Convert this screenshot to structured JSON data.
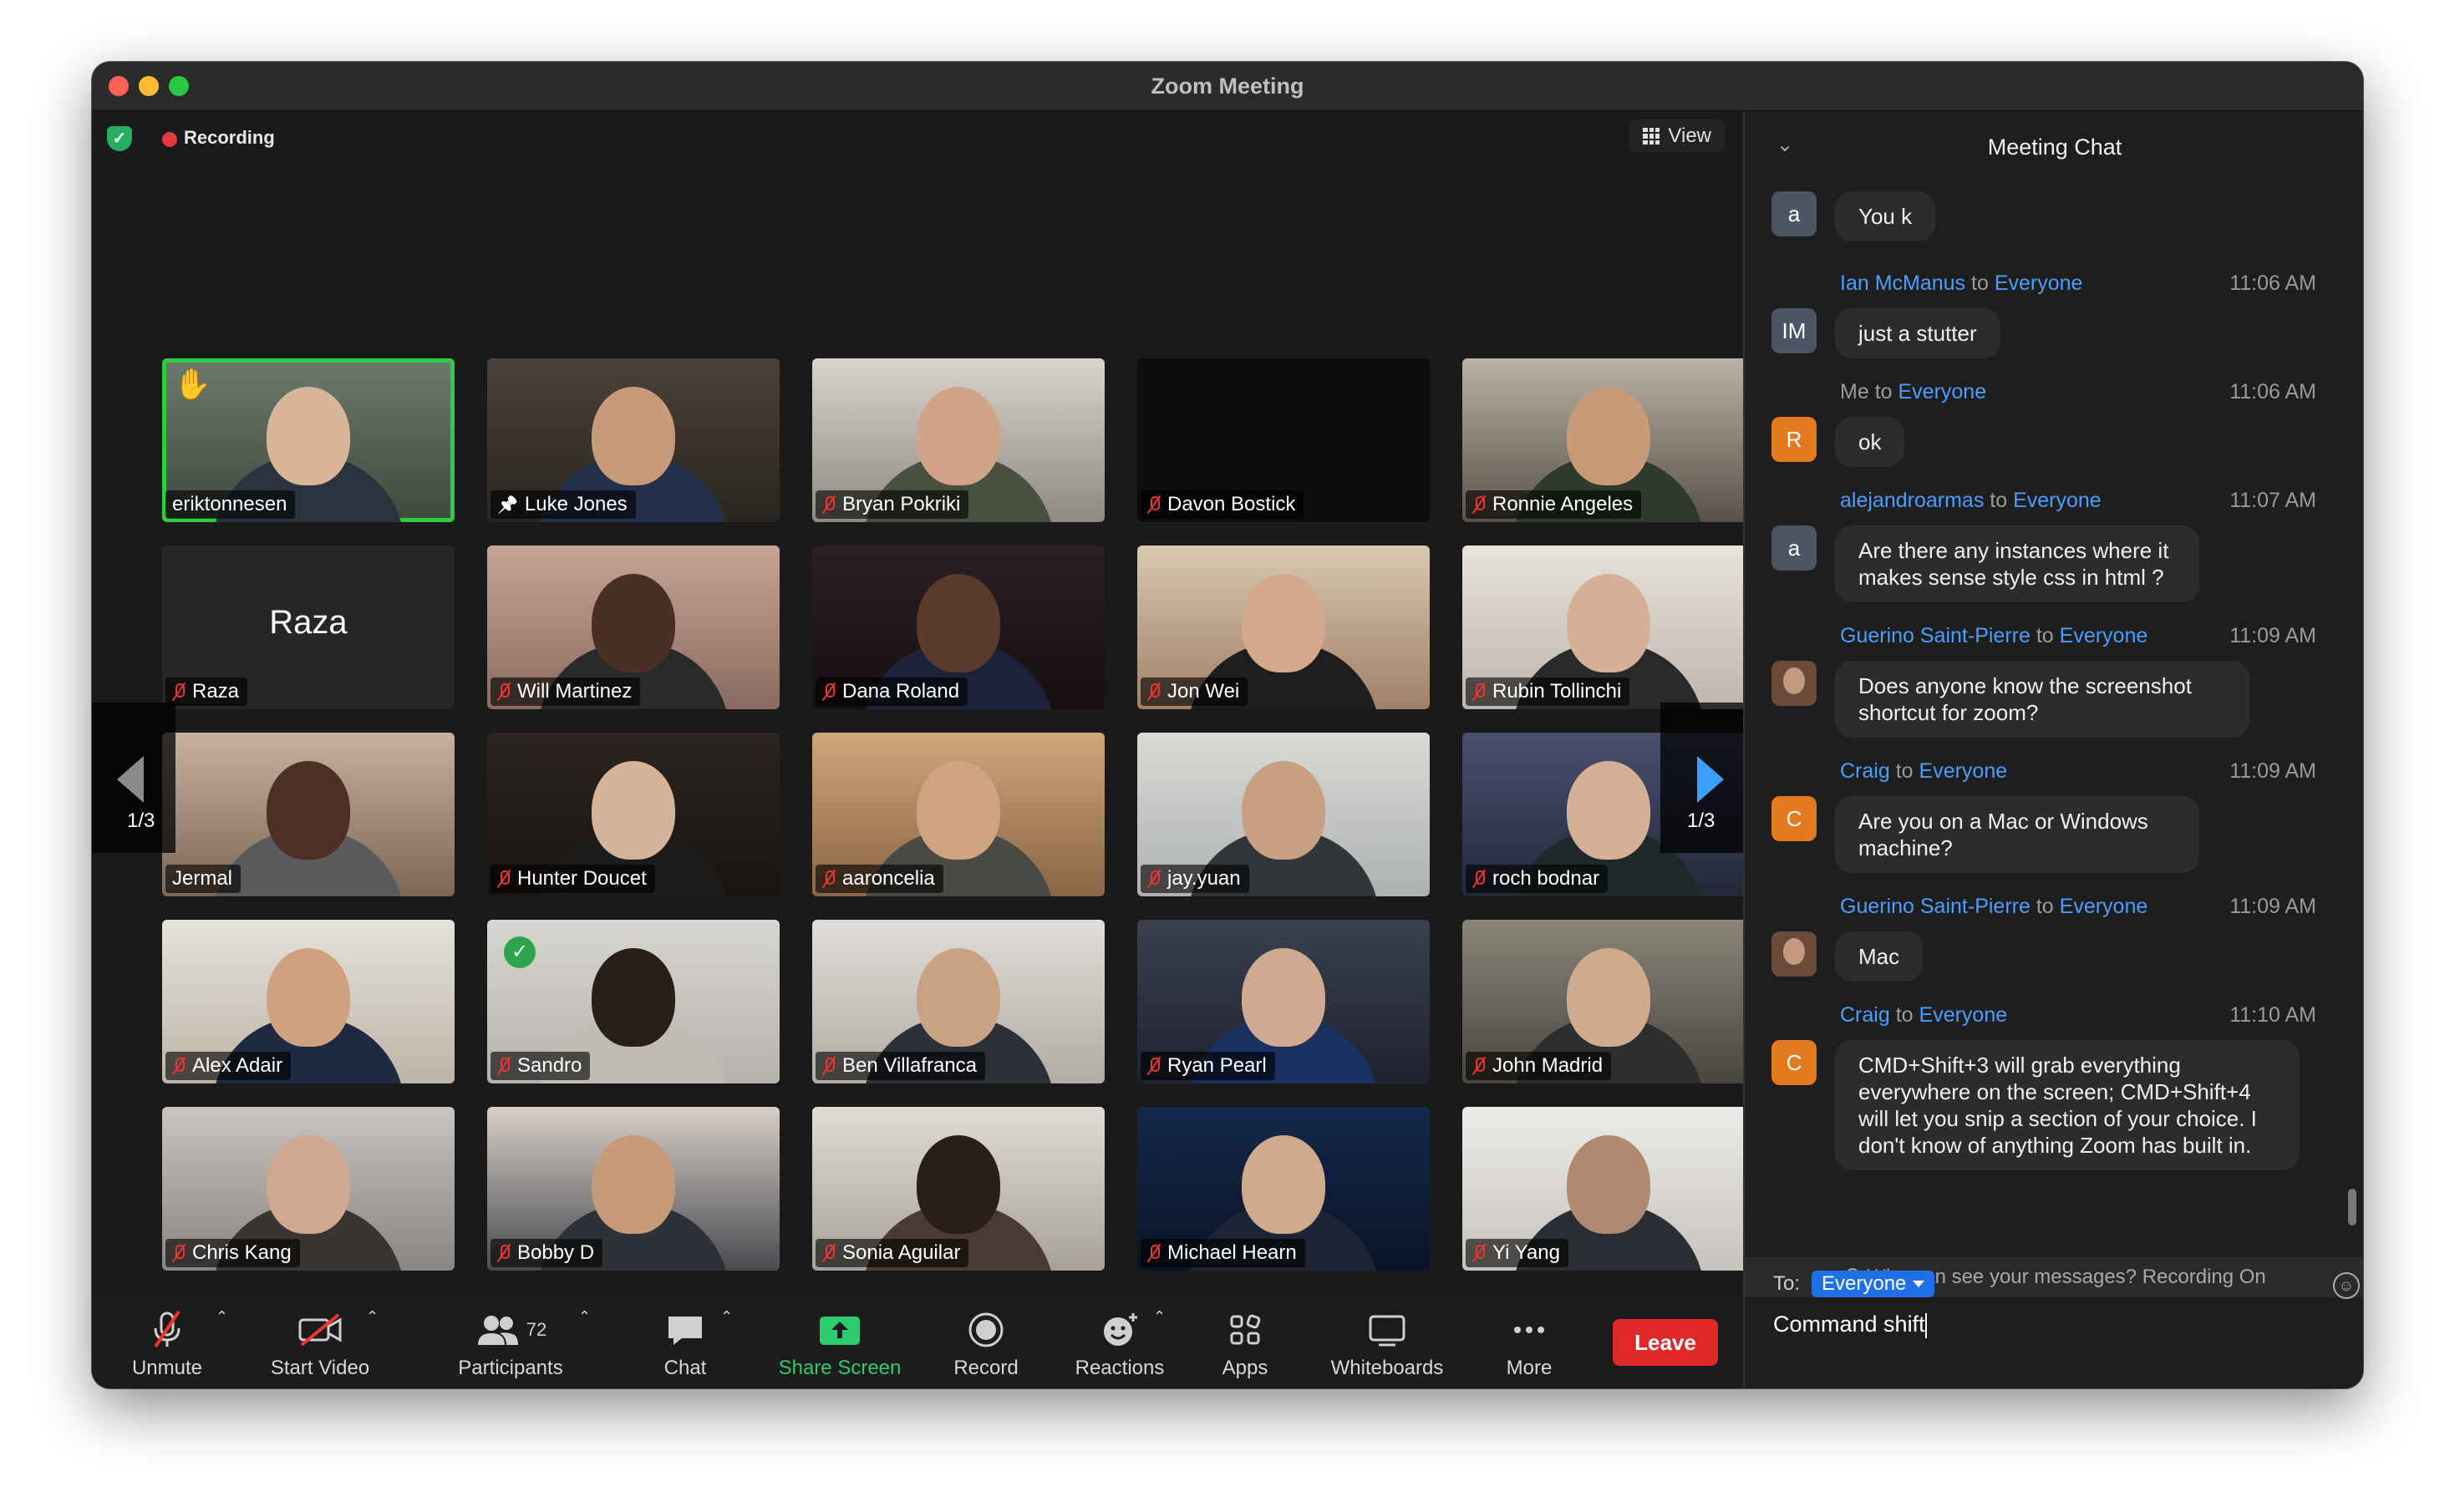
{
  "window": {
    "title": "Zoom Meeting"
  },
  "status": {
    "recording_label": "Recording",
    "view_label": "View"
  },
  "pagination": {
    "left": "1/3",
    "right": "1/3"
  },
  "participants": [
    {
      "name": "eriktonnesen",
      "muted": false,
      "active_speaker": true,
      "hand_raised": true,
      "pinned": false
    },
    {
      "name": "Luke Jones",
      "muted": false,
      "pinned": true
    },
    {
      "name": "Bryan Pokriki",
      "muted": true
    },
    {
      "name": "Davon Bostick",
      "muted": true,
      "video_off": true
    },
    {
      "name": "Ronnie Angeles",
      "muted": true
    },
    {
      "name": "Raza",
      "muted": true,
      "video_off": true,
      "display_name_large": "Raza"
    },
    {
      "name": "Will Martinez",
      "muted": true
    },
    {
      "name": "Dana Roland",
      "muted": true
    },
    {
      "name": "Jon Wei",
      "muted": true
    },
    {
      "name": "Rubin Tollinchi",
      "muted": true
    },
    {
      "name": "Jermal",
      "muted": false
    },
    {
      "name": "Hunter Doucet",
      "muted": true
    },
    {
      "name": "aaroncelia",
      "muted": true
    },
    {
      "name": "jay.yuan",
      "muted": true
    },
    {
      "name": "roch bodnar",
      "muted": true
    },
    {
      "name": "Alex Adair",
      "muted": true
    },
    {
      "name": "Sandro",
      "muted": true,
      "badge": "check"
    },
    {
      "name": "Ben Villafranca",
      "muted": true
    },
    {
      "name": "Ryan Pearl",
      "muted": true
    },
    {
      "name": "John Madrid",
      "muted": true
    },
    {
      "name": "Chris Kang",
      "muted": true
    },
    {
      "name": "Bobby D",
      "muted": true
    },
    {
      "name": "Sonia Aguilar",
      "muted": true
    },
    {
      "name": "Michael Hearn",
      "muted": true
    },
    {
      "name": "Yi Yang",
      "muted": true
    }
  ],
  "toolbar": {
    "unmute": "Unmute",
    "start_video": "Start Video",
    "participants": "Participants",
    "participants_count": "72",
    "chat": "Chat",
    "share_screen": "Share Screen",
    "record": "Record",
    "reactions": "Reactions",
    "apps": "Apps",
    "whiteboards": "Whiteboards",
    "more": "More",
    "leave": "Leave"
  },
  "chat": {
    "title": "Meeting Chat",
    "messages": [
      {
        "avatar": "a",
        "avatar_color": "gray",
        "sender": "",
        "recipient": "",
        "time": "",
        "text": "You k"
      },
      {
        "avatar": "IM",
        "avatar_color": "gray",
        "sender": "Ian McManus",
        "to_word": "to",
        "recipient": "Everyone",
        "time": "11:06 AM",
        "text": "just a stutter"
      },
      {
        "avatar": "R",
        "avatar_color": "orange",
        "sender": "Me",
        "to_word": "to",
        "recipient": "Everyone",
        "time": "11:06 AM",
        "text": "ok"
      },
      {
        "avatar": "a",
        "avatar_color": "gray",
        "sender": "alejandroarmas",
        "to_word": "to",
        "recipient": "Everyone",
        "time": "11:07 AM",
        "text": "Are there any instances where it makes sense style css in html ?"
      },
      {
        "avatar": "",
        "avatar_color": "photo",
        "sender": "Guerino Saint-Pierre",
        "to_word": "to",
        "recipient": "Everyone",
        "time": "11:09 AM",
        "text": "Does anyone know the screenshot shortcut for zoom?"
      },
      {
        "avatar": "C",
        "avatar_color": "orange",
        "sender": "Craig",
        "to_word": "to",
        "recipient": "Everyone",
        "time": "11:09 AM",
        "text": "Are you on a Mac or Windows machine?"
      },
      {
        "avatar": "",
        "avatar_color": "photo",
        "sender": "Guerino Saint-Pierre",
        "to_word": "to",
        "recipient": "Everyone",
        "time": "11:09 AM",
        "text": "Mac"
      },
      {
        "avatar": "C",
        "avatar_color": "orange",
        "sender": "Craig",
        "to_word": "to",
        "recipient": "Everyone",
        "time": "11:10 AM",
        "text": "CMD+Shift+3 will grab everything everywhere on the screen; CMD+Shift+4 will let you snip a section of your choice.  I don't know of anything Zoom has built in."
      }
    ],
    "privacy_notice": "Who can see your messages? Recording On",
    "to_label": "To:",
    "to_value": "Everyone",
    "compose_value": "Command shift"
  },
  "colors": {
    "accent_blue": "#4a9eff",
    "leave_red": "#e02828",
    "share_green": "#2ecc71",
    "active_speaker_green": "#2ecc40"
  },
  "icons": [
    "shield-icon",
    "recording-dot-icon",
    "grid-view-icon",
    "mic-muted-icon",
    "video-off-icon",
    "participants-icon",
    "chat-icon",
    "share-screen-icon",
    "record-icon",
    "reactions-icon",
    "apps-icon",
    "whiteboard-icon",
    "more-icon",
    "chevron-down-icon",
    "emoji-icon",
    "person-icon"
  ]
}
